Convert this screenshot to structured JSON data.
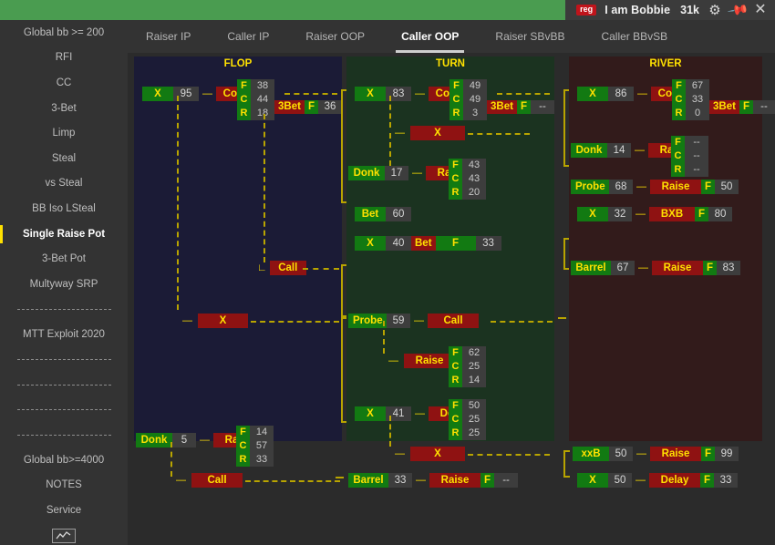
{
  "topbar": {
    "badge": "reg",
    "player_name": "I am Bobbie",
    "stack": "31k",
    "gear_icon": "gear-icon",
    "pin_icon": "pin-icon",
    "close_icon": "close-icon",
    "green_color": "#4a9c50",
    "badge_color": "#c0141b"
  },
  "sidebar": {
    "items": [
      {
        "label": "Global bb >= 200",
        "type": "item",
        "active": false
      },
      {
        "label": "RFI",
        "type": "item",
        "active": false
      },
      {
        "label": "CC",
        "type": "item",
        "active": false
      },
      {
        "label": "3-Bet",
        "type": "item",
        "active": false
      },
      {
        "label": "Limp",
        "type": "item",
        "active": false
      },
      {
        "label": "Steal",
        "type": "item",
        "active": false
      },
      {
        "label": "vs Steal",
        "type": "item",
        "active": false
      },
      {
        "label": "BB Iso LSteal",
        "type": "item",
        "active": false
      },
      {
        "label": "Single Raise Pot",
        "type": "item",
        "active": true
      },
      {
        "label": "3-Bet Pot",
        "type": "item",
        "active": false
      },
      {
        "label": "Multyway SRP",
        "type": "item",
        "active": false
      },
      {
        "label": "",
        "type": "sep",
        "active": false
      },
      {
        "label": "MTT Exploit 2020",
        "type": "item",
        "active": false
      },
      {
        "label": "",
        "type": "sep",
        "active": false
      },
      {
        "label": "",
        "type": "sep",
        "active": false
      },
      {
        "label": "",
        "type": "sep",
        "active": false
      },
      {
        "label": "",
        "type": "sep",
        "active": false
      },
      {
        "label": "Global bb>=4000",
        "type": "item",
        "active": false
      },
      {
        "label": "NOTES",
        "type": "item",
        "active": false
      },
      {
        "label": "Service",
        "type": "item",
        "active": false
      },
      {
        "label": "",
        "type": "chart",
        "active": false
      }
    ]
  },
  "tabs": [
    {
      "label": "Raiser IP",
      "active": false
    },
    {
      "label": "Caller IP",
      "active": false
    },
    {
      "label": "Raiser OOP",
      "active": false
    },
    {
      "label": "Caller OOP",
      "active": true
    },
    {
      "label": "Raiser SBvBB",
      "active": false
    },
    {
      "label": "Caller BBvSB",
      "active": false
    }
  ],
  "columns": {
    "flop": {
      "title": "FLOP",
      "nodes": [
        {
          "action": "X",
          "freq": "95",
          "response": "ContBet",
          "fcr": {
            "F": "38",
            "C": "44",
            "R": "18"
          },
          "extra_label": "3Bet",
          "extra_f": "F",
          "extra_v": "36"
        },
        {
          "action": null,
          "freq": null,
          "response": "Call",
          "fcr": null
        },
        {
          "action": null,
          "freq": null,
          "response": "X",
          "fcr": null
        },
        {
          "action": "Donk",
          "freq": "5",
          "response": "Raise",
          "fcr": {
            "F": "14",
            "C": "57",
            "R": "33"
          }
        },
        {
          "action": null,
          "freq": null,
          "response": "Call",
          "fcr": null
        }
      ]
    },
    "turn": {
      "title": "TURN",
      "nodes": [
        {
          "action": "X",
          "freq": "83",
          "response": "ContBet",
          "fcr": {
            "F": "49",
            "C": "49",
            "R": "3"
          },
          "extra_label": "3Bet",
          "extra_f": "F",
          "extra_v": "--"
        },
        {
          "action": null,
          "freq": null,
          "response": "X",
          "fcr": null
        },
        {
          "action": "Donk",
          "freq": "17",
          "response": "Raise",
          "fcr": {
            "F": "43",
            "C": "43",
            "R": "20"
          }
        },
        {
          "action": "Bet",
          "freq": "60",
          "response": null,
          "fcr": null
        },
        {
          "action": "X",
          "freq": "40",
          "response": "Bet",
          "inline_f": "F",
          "inline_v": "33"
        },
        {
          "action": "Probe",
          "freq": "59",
          "response": "Call",
          "fcr": null
        },
        {
          "action": null,
          "freq": null,
          "response": "Raise",
          "fcr": {
            "F": "62",
            "C": "25",
            "R": "14"
          }
        },
        {
          "action": "X",
          "freq": "41",
          "response": "Delay",
          "fcr": {
            "F": "50",
            "C": "25",
            "R": "25"
          }
        },
        {
          "action": null,
          "freq": null,
          "response": "X",
          "fcr": null
        },
        {
          "action": "Barrel",
          "freq": "33",
          "response": "Raise",
          "inline_f": "F",
          "inline_v": "--"
        }
      ]
    },
    "river": {
      "title": "RIVER",
      "nodes": [
        {
          "action": "X",
          "freq": "86",
          "response": "ContBet",
          "fcr": {
            "F": "67",
            "C": "33",
            "R": "0"
          },
          "extra_label": "3Bet",
          "extra_f": "F",
          "extra_v": "--"
        },
        {
          "action": "Donk",
          "freq": "14",
          "response": "Raise",
          "fcr": {
            "F": "--",
            "C": "--",
            "R": "--"
          }
        },
        {
          "action": "Probe",
          "freq": "68",
          "response": "Raise",
          "inline_f": "F",
          "inline_v": "50"
        },
        {
          "action": "X",
          "freq": "32",
          "response": "BXB",
          "inline_f": "F",
          "inline_v": "80"
        },
        {
          "action": "Barrel",
          "freq": "67",
          "response": "Raise",
          "inline_f": "F",
          "inline_v": "83"
        },
        {
          "action": "xxB",
          "freq": "50",
          "response": "Raise",
          "inline_f": "F",
          "inline_v": "99"
        },
        {
          "action": "X",
          "freq": "50",
          "response": "Delay",
          "inline_f": "F",
          "inline_v": "33"
        }
      ]
    }
  },
  "colors": {
    "green_chip": "#127a12",
    "red_chip": "#8f1212",
    "yellow_text": "#ffe100",
    "grey_value": "#3d3d3d",
    "flop_bg": "#1b1b36",
    "turn_bg": "#1b3320",
    "river_bg": "#321b1b",
    "accent_active": "#ffe100"
  }
}
